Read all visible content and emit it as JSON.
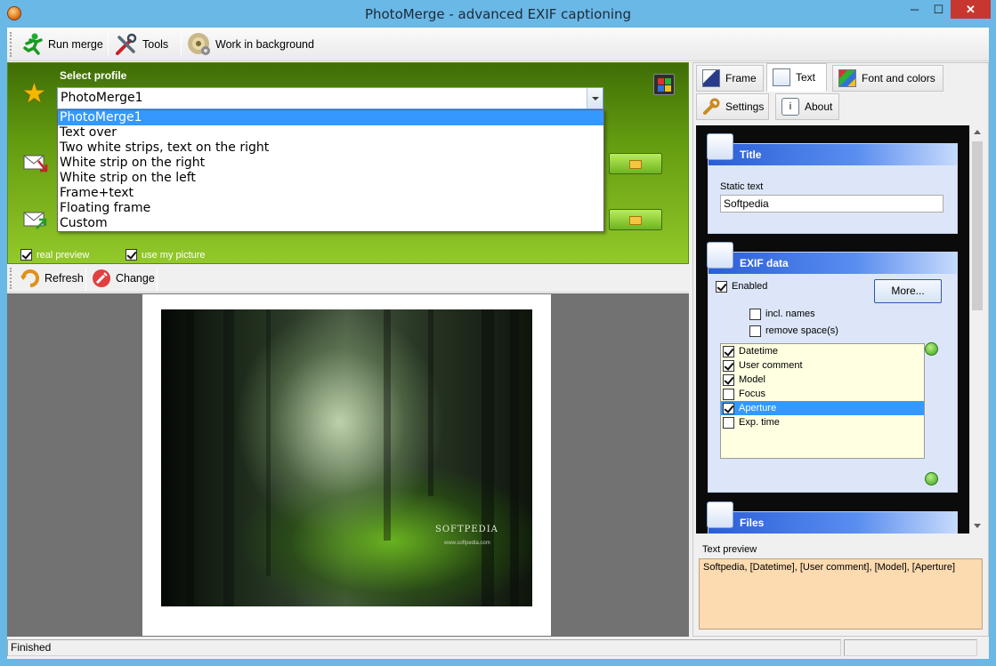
{
  "window": {
    "title": "PhotoMerge - advanced EXIF captioning",
    "min_icon": "─",
    "max_icon": "☐",
    "close_icon": "✕"
  },
  "toolbar": {
    "run_merge": "Run merge",
    "tools": "Tools",
    "work_in_background": "Work in background"
  },
  "profile": {
    "label": "Select profile",
    "selected": "PhotoMerge1",
    "options": [
      "PhotoMerge1",
      "Text over",
      "Two white strips, text on the right",
      "White strip on the right",
      "White strip on the left",
      "Frame+text",
      "Floating frame",
      "Custom"
    ],
    "real_preview_label": "real preview",
    "use_my_picture_label": "use my picture"
  },
  "preview_toolbar": {
    "refresh": "Refresh",
    "change": "Change"
  },
  "preview": {
    "watermark": "SOFTPEDIA",
    "watermark_sub": "www.softpedia.com"
  },
  "tabs": [
    {
      "label": "Frame",
      "active": false
    },
    {
      "label": "Text",
      "active": true
    },
    {
      "label": "Font and colors",
      "active": false
    },
    {
      "label": "Settings",
      "active": false
    },
    {
      "label": "About",
      "active": false
    }
  ],
  "title_group": {
    "heading": "Title",
    "static_text_label": "Static text",
    "static_text_value": "Softpedia"
  },
  "exif_group": {
    "heading": "EXIF data",
    "enabled_label": "Enabled",
    "more_button": "More...",
    "incl_names_label": "incl. names",
    "remove_spaces_label": "remove space(s)",
    "items": [
      {
        "label": "Datetime",
        "checked": true,
        "selected": false
      },
      {
        "label": "User comment",
        "checked": true,
        "selected": false
      },
      {
        "label": "Model",
        "checked": true,
        "selected": false
      },
      {
        "label": "Focus",
        "checked": false,
        "selected": false
      },
      {
        "label": "Aperture",
        "checked": true,
        "selected": true
      },
      {
        "label": "Exp. time",
        "checked": false,
        "selected": false
      }
    ]
  },
  "files_group": {
    "heading": "Files"
  },
  "text_preview": {
    "label": "Text preview",
    "value": "Softpedia, [Datetime], [User comment], [Model], [Aperture]"
  },
  "status": {
    "text": "Finished"
  }
}
